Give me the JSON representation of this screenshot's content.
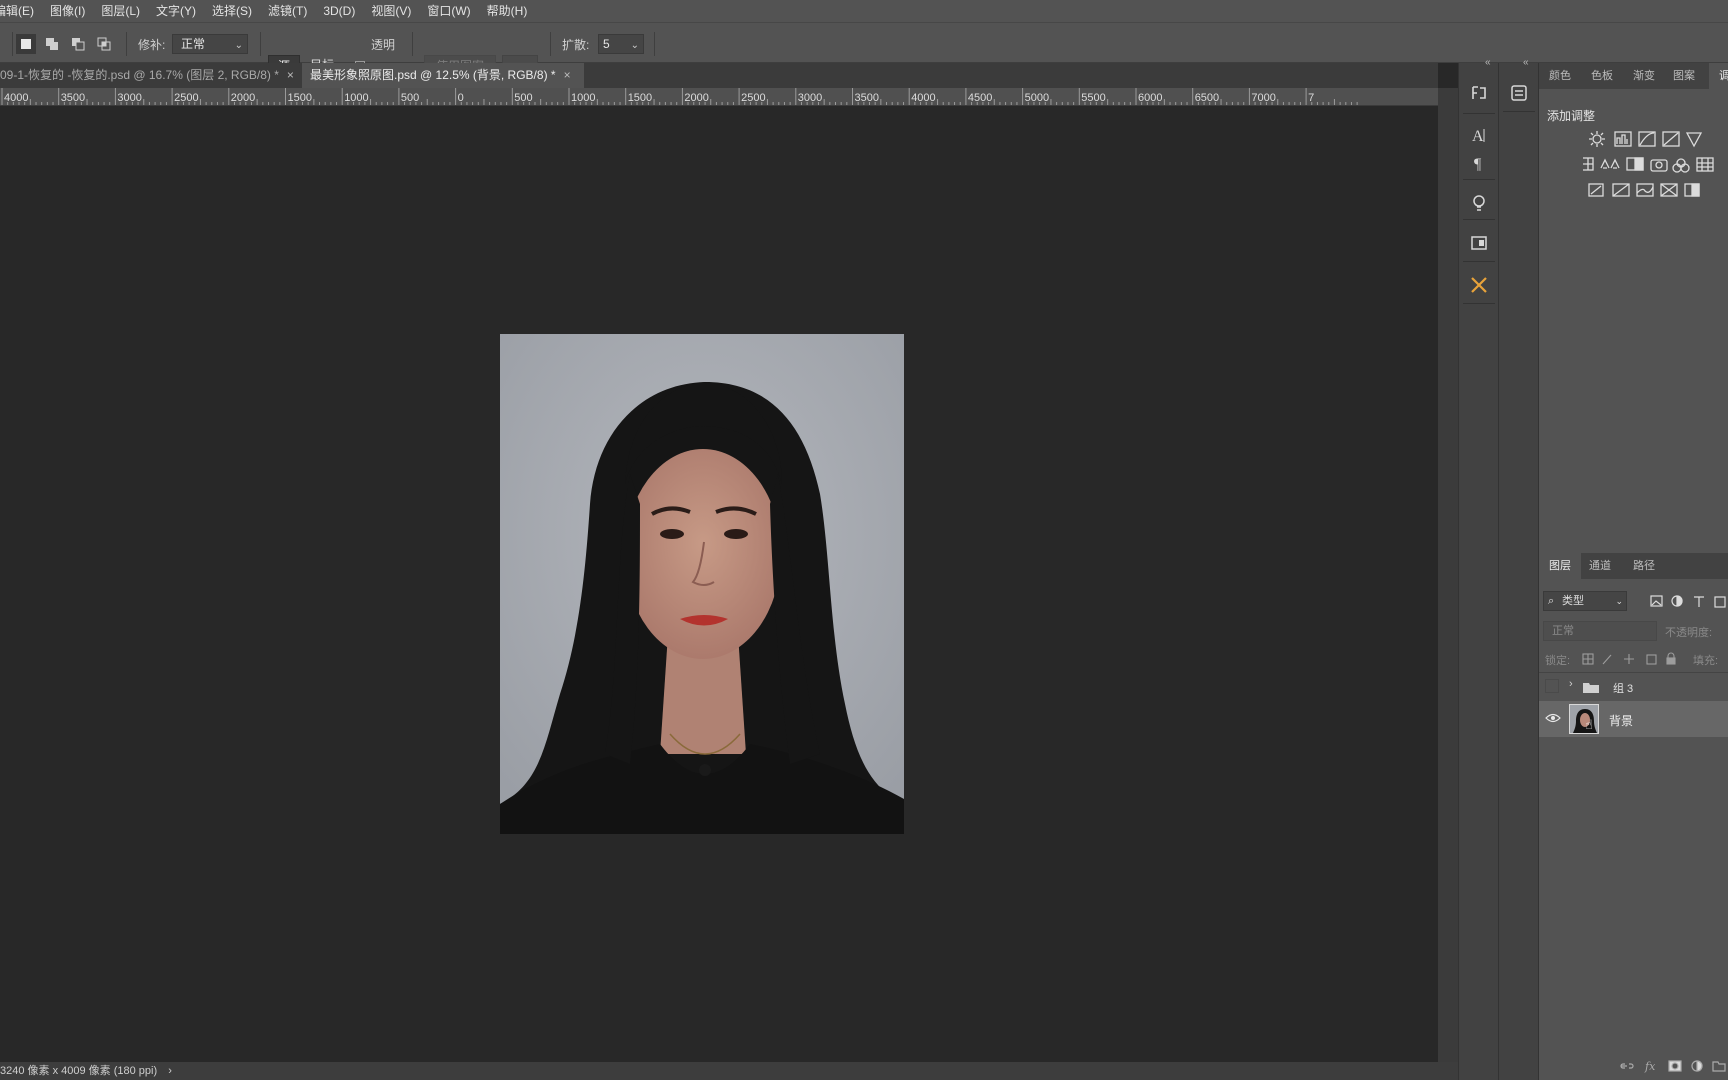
{
  "menu": [
    "编辑(E)",
    "图像(I)",
    "图层(L)",
    "文字(Y)",
    "选择(S)",
    "滤镜(T)",
    "3D(D)",
    "视图(V)",
    "窗口(W)",
    "帮助(H)"
  ],
  "options": {
    "patch_label": "修补:",
    "patch_value": "正常",
    "source_label": "源",
    "target_label": "目标",
    "transparent_label": "透明",
    "use_pattern_label": "使用图案",
    "diffusion_label": "扩散:",
    "diffusion_value": "5"
  },
  "tabs": [
    {
      "title": "09-1-恢复的 -恢复的.psd @ 16.7% (图层 2, RGB/8) *",
      "active": false
    },
    {
      "title": "最美形象照原图.psd @ 12.5% (背景, RGB/8) *",
      "active": true
    }
  ],
  "ruler_ticks": [
    "4000",
    "3500",
    "3000",
    "2500",
    "2000",
    "1500",
    "1000",
    "500",
    "0",
    "500",
    "1000",
    "1500",
    "2000",
    "2500",
    "3000",
    "3500",
    "4000",
    "4500",
    "5000",
    "5500",
    "6000",
    "6500",
    "7000",
    "7"
  ],
  "status": {
    "text": "3240 像素 x 4009 像素 (180 ppi)",
    "arrow": "›"
  },
  "top_panel": {
    "tabs": [
      "颜色",
      "色板",
      "渐变",
      "图案",
      "调"
    ],
    "active_tab": "调",
    "heading": "添加调整"
  },
  "layers_panel": {
    "tabs": [
      "图层",
      "通道",
      "路径"
    ],
    "filter_label": "类型",
    "blend_mode": "正常",
    "opacity_label": "不透明度:",
    "lock_label": "锁定:",
    "fill_label": "填充:",
    "layers": [
      {
        "name": "组 3",
        "type": "group",
        "visible": false
      },
      {
        "name": "背景",
        "type": "image",
        "visible": true,
        "selected": true
      }
    ]
  },
  "colors": {
    "ui_bg": "#535353",
    "canvas_bg": "#282828",
    "photo_bg": "#a4a7ad",
    "accent": "#e8a33a"
  }
}
